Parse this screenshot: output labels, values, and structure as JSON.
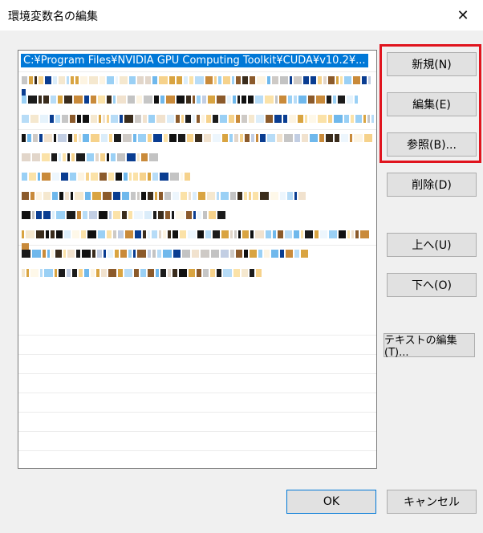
{
  "window": {
    "title": "環境変数名の編集",
    "close_icon": "close-icon"
  },
  "list": {
    "selected_item": "C:¥Program Files¥NVIDIA GPU Computing Toolkit¥CUDA¥v10.2¥...",
    "blurred_rows": 11,
    "empty_rows": 10
  },
  "buttons": {
    "new": "新規(N)",
    "edit": "編集(E)",
    "browse": "参照(B)...",
    "delete": "削除(D)",
    "up": "上へ(U)",
    "down": "下へ(O)",
    "edit_text": "テキストの編集(T)...",
    "ok": "OK",
    "cancel": "キャンセル"
  },
  "colors": {
    "selection": "#0078d7",
    "highlight_box": "#e0141e"
  }
}
